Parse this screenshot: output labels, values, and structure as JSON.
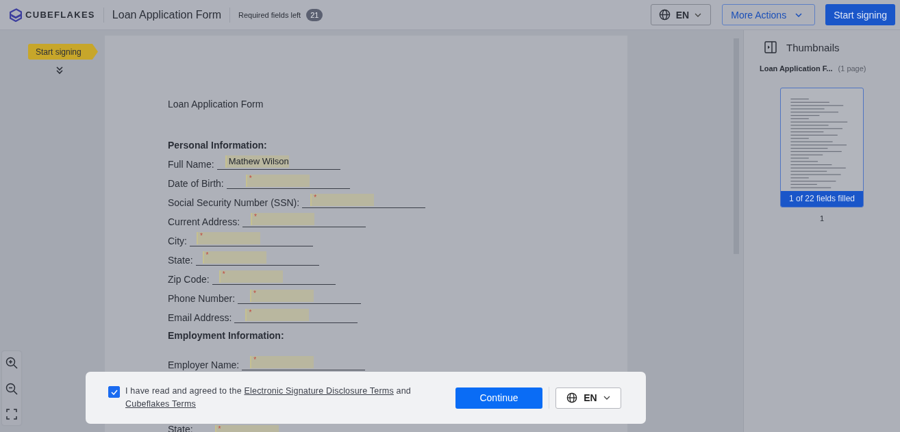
{
  "header": {
    "logo": "CUBEFLAKES",
    "title": "Loan Application Form",
    "required_label": "Required fields left",
    "required_count": "21",
    "language": "EN",
    "more_actions": "More Actions",
    "start_signing": "Start signing"
  },
  "guide": {
    "label": "Start signing"
  },
  "document": {
    "title": "Loan Application Form",
    "sections": [
      {
        "heading": "Personal Information:",
        "fields": [
          {
            "label": "Full Name:",
            "value": "Mathew Wilson"
          },
          {
            "label": "Date of Birth:",
            "marker": "*"
          },
          {
            "label": "Social Security Number (SSN):",
            "marker": "*"
          },
          {
            "label": "Current Address:",
            "marker": "*"
          },
          {
            "label": "City:",
            "marker": "*"
          },
          {
            "label": "State:",
            "marker": "*"
          },
          {
            "label": "Zip Code:",
            "marker": "*"
          },
          {
            "label": "Phone Number:",
            "marker": "*"
          },
          {
            "label": "Email Address:",
            "marker": "*"
          }
        ]
      },
      {
        "heading": "Employment Information:",
        "fields": [
          {
            "label": "Employer Name:",
            "marker": "*"
          },
          {
            "label": "State:",
            "marker": "*"
          }
        ]
      }
    ]
  },
  "thumbnails": {
    "title": "Thumbnails",
    "file_name": "Loan Application F...",
    "page_count": "(1 page)",
    "pages": [
      {
        "progress": "1 of 22 fields filled",
        "number": "1",
        "selected": true
      }
    ]
  },
  "consent": {
    "checked": true,
    "text_before": "I have read and agreed to the",
    "link_1": "Electronic Signature Disclosure Terms",
    "text_middle": "and",
    "link_2": "Cubeflakes Terms",
    "continue": "Continue",
    "language": "EN"
  }
}
